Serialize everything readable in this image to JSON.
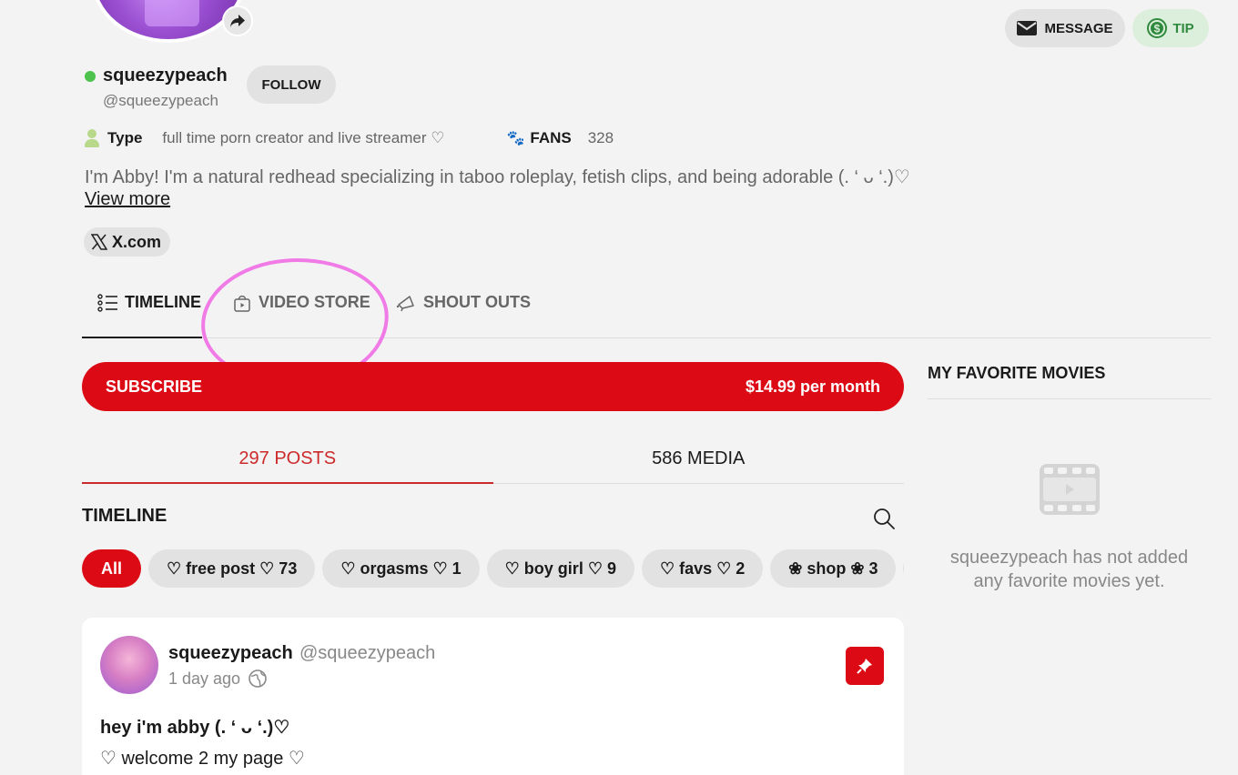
{
  "profile": {
    "display_name": "squeezypeach",
    "handle": "@squeezypeach",
    "follow_label": "FOLLOW",
    "type_label": "Type",
    "type_value": "full time porn creator and live streamer ♡",
    "fans_label": "FANS",
    "fans_count": "328",
    "bio": "I'm Abby! I'm a natural redhead specializing in taboo roleplay, fetish clips, and being adorable (. ‘ ᴗ ‘.)♡",
    "view_more": "View more",
    "social_link": "X.com"
  },
  "actions": {
    "message_label": "MESSAGE",
    "tip_label": "TIP"
  },
  "nav_tabs": [
    {
      "label": "TIMELINE"
    },
    {
      "label": "VIDEO STORE"
    },
    {
      "label": "SHOUT OUTS"
    }
  ],
  "subscribe": {
    "label": "SUBSCRIBE",
    "price": "$14.99 per month"
  },
  "content_tabs": [
    {
      "label": "297 POSTS"
    },
    {
      "label": "586 MEDIA"
    }
  ],
  "timeline": {
    "title": "TIMELINE",
    "chips": [
      {
        "label": "All"
      },
      {
        "label": "♡ free post ♡ 73"
      },
      {
        "label": "♡ orgasms ♡ 1"
      },
      {
        "label": "♡ boy girl ♡ 9"
      },
      {
        "label": "♡ favs ♡ 2"
      },
      {
        "label": "❀ shop ❀ 3"
      },
      {
        "label": "❀"
      }
    ]
  },
  "post": {
    "author": "squeezypeach",
    "handle": "@squeezypeach",
    "time": "1 day ago",
    "line1": "hey i'm abby (. ‘ ᴗ ‘.)♡",
    "line2": "♡ welcome 2 my page ♡"
  },
  "sidebar": {
    "title": "MY FAVORITE MOVIES",
    "empty_line1": "squeezypeach has not added",
    "empty_line2": "any favorite movies yet."
  },
  "colors": {
    "accent_red": "#dc0a14",
    "tip_green": "#2f8a3e",
    "online_green": "#4cc34c",
    "annotation_pink": "#f07ae6"
  }
}
